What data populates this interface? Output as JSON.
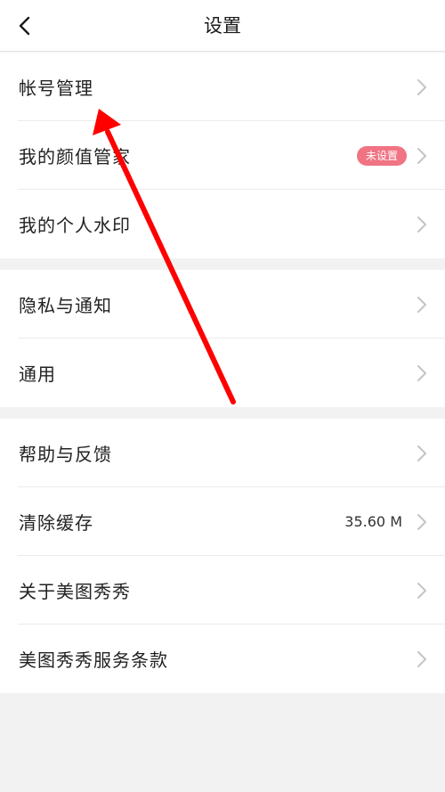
{
  "header": {
    "title": "设置",
    "back_icon": "chevron-left-icon"
  },
  "groups": [
    {
      "items": [
        {
          "label": "帐号管理"
        },
        {
          "label": "我的颜值管家",
          "badge": "未设置",
          "badge_color": "#f07483"
        },
        {
          "label": "我的个人水印"
        }
      ]
    },
    {
      "items": [
        {
          "label": "隐私与通知"
        },
        {
          "label": "通用"
        }
      ]
    },
    {
      "items": [
        {
          "label": "帮助与反馈"
        },
        {
          "label": "清除缓存",
          "value": "35.60 M"
        },
        {
          "label": "关于美图秀秀"
        },
        {
          "label": "美图秀秀服务条款"
        }
      ]
    }
  ],
  "annotation": {
    "type": "red-arrow",
    "color": "#ff0000",
    "points_to": "帐号管理"
  },
  "colors": {
    "background": "#f2f2f2",
    "card": "#ffffff",
    "chevron": "#c4c4c4"
  }
}
